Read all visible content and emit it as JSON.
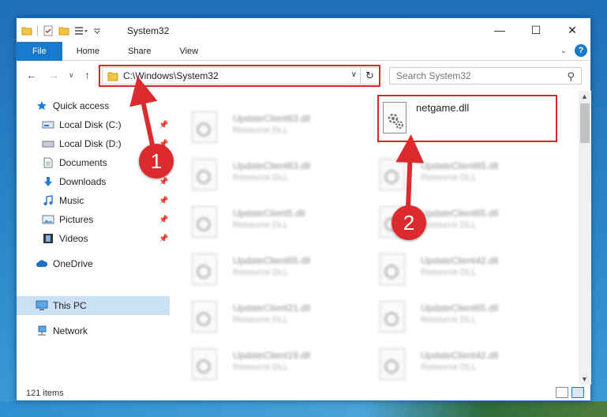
{
  "window": {
    "title": "System32"
  },
  "ribbon": {
    "tabs": [
      "File",
      "Home",
      "Share",
      "View"
    ]
  },
  "address": {
    "path": "C:\\Windows\\System32",
    "search_placeholder": "Search System32"
  },
  "sidebar": {
    "items": [
      {
        "label": "Quick access",
        "icon": "star-icon"
      },
      {
        "label": "Local Disk (C:)",
        "icon": "drive-icon"
      },
      {
        "label": "Local Disk (D:)",
        "icon": "drive-icon"
      },
      {
        "label": "Documents",
        "icon": "documents-icon"
      },
      {
        "label": "Downloads",
        "icon": "download-icon"
      },
      {
        "label": "Music",
        "icon": "music-icon"
      },
      {
        "label": "Pictures",
        "icon": "pictures-icon"
      },
      {
        "label": "Videos",
        "icon": "videos-icon"
      },
      {
        "label": "OneDrive",
        "icon": "cloud-icon"
      },
      {
        "label": "This PC",
        "icon": "computer-icon"
      },
      {
        "label": "Network",
        "icon": "network-icon"
      }
    ]
  },
  "files": {
    "left_column": [
      {
        "name": "UpdateClient63.dll",
        "type": "Resource DLL"
      },
      {
        "name": "UpdateClient63.dll",
        "type": "Resource DLL"
      },
      {
        "name": "UpdateClient5.dll",
        "type": "Resource DLL"
      },
      {
        "name": "UpdateClient65.dll",
        "type": "Resource DLL"
      },
      {
        "name": "UpdateClient21.dll",
        "type": "Resource DLL"
      },
      {
        "name": "UpdateClient19.dll",
        "type": "Resource DLL"
      }
    ],
    "right_column": [
      {
        "name": "UpdateClient65.dll",
        "type": "Resource DLL"
      },
      {
        "name": "UpdateClient65.dll",
        "type": "Resource DLL"
      },
      {
        "name": "UpdateClient42.dll",
        "type": "Resource DLL"
      },
      {
        "name": "UpdateClient65.dll",
        "type": "Resource DLL"
      },
      {
        "name": "UpdateClient42.dll",
        "type": "Resource DLL"
      }
    ],
    "highlighted": {
      "name": "netgame.dll"
    }
  },
  "status": {
    "item_count": "121 items"
  },
  "callouts": {
    "one": "1",
    "two": "2"
  },
  "colors": {
    "accent": "#1979ca",
    "highlight": "#d9262d"
  }
}
